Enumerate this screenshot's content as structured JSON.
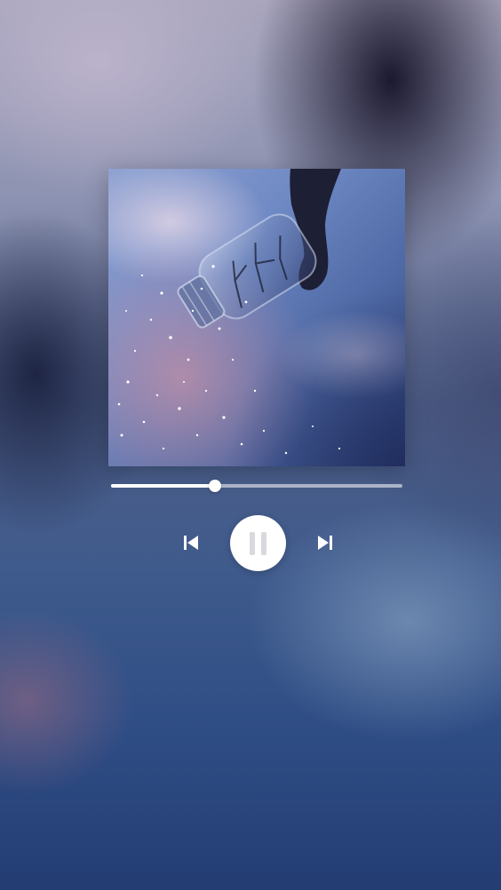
{
  "player": {
    "progress_fraction": 0.357,
    "state": "playing",
    "controls": {
      "previous_icon": "skip-previous-icon",
      "play_pause_icon": "pause-icon",
      "next_icon": "skip-next-icon"
    },
    "artwork_description_icon": "album-artwork"
  },
  "colors": {
    "track_fill": "#ffffff",
    "track_background": "rgba(255,255,255,0.55)",
    "button_background": "#ffffff",
    "pause_glyph": "#d9d9dd"
  }
}
